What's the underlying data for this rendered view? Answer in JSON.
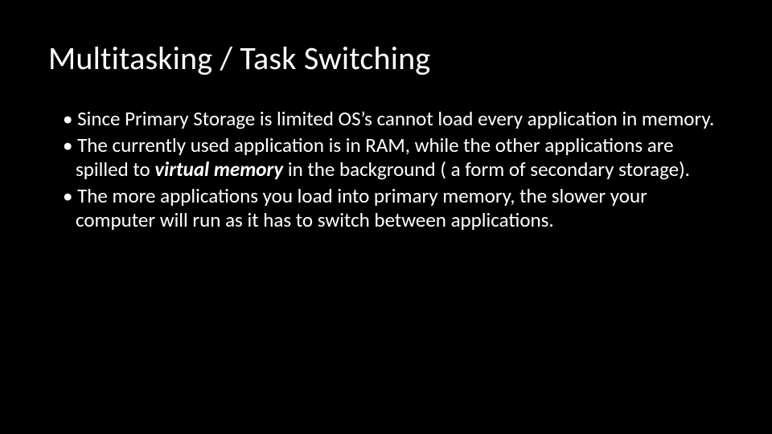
{
  "slide": {
    "title": "Multitasking / Task Switching",
    "bullets": [
      {
        "pre": "Since Primary Storage is limited OS’s cannot load every application in memory.",
        "em": "",
        "post": ""
      },
      {
        "pre": "The currently used application is in RAM, while the other applications are spilled to ",
        "em": "virtual memory",
        "post": " in the background ( a form of secondary storage)."
      },
      {
        "pre": "The more applications you load into primary memory, the slower your computer will run as it has to switch between applications.",
        "em": "",
        "post": ""
      }
    ]
  }
}
